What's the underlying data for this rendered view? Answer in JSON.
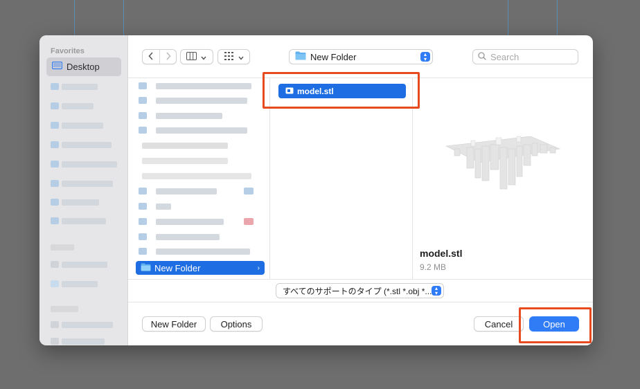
{
  "sidebar": {
    "heading": "Favorites",
    "items": [
      {
        "label": "Desktop",
        "icon": "desktop-icon",
        "selected": true
      }
    ]
  },
  "toolbar": {
    "back_icon": "chevron-left-icon",
    "forward_icon": "chevron-right-icon",
    "view_icon": "column-view-icon",
    "group_icon": "grid-group-icon",
    "path_label": "New Folder",
    "search_placeholder": "Search"
  },
  "browser": {
    "column1_selected": "New Folder",
    "column2_selected": "model.stl"
  },
  "preview": {
    "name": "model.stl",
    "size": "9.2 MB"
  },
  "filter": {
    "selected": "すべてのサポートのタイプ (*.stl *.obj *...."
  },
  "footer": {
    "new_folder": "New Folder",
    "options": "Options",
    "cancel": "Cancel",
    "open": "Open"
  },
  "colors": {
    "accent": "#2f7cf6",
    "selection": "#1e6de3",
    "highlight_box": "#e84a1f"
  }
}
